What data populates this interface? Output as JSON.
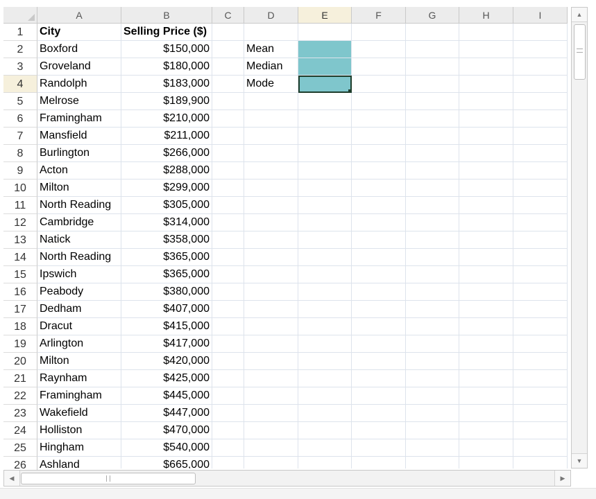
{
  "columns": [
    "A",
    "B",
    "C",
    "D",
    "E",
    "F",
    "G",
    "H",
    "I"
  ],
  "active_column": "E",
  "active_row": 4,
  "rows": [
    {
      "n": "1",
      "A": "City",
      "B": "Selling Price ($)",
      "D": ""
    },
    {
      "n": "2",
      "A": "Boxford",
      "B": "$150,000",
      "D": "Mean"
    },
    {
      "n": "3",
      "A": "Groveland",
      "B": "$180,000",
      "D": "Median"
    },
    {
      "n": "4",
      "A": "Randolph",
      "B": "$183,000",
      "D": "Mode"
    },
    {
      "n": "5",
      "A": "Melrose",
      "B": "$189,900",
      "D": ""
    },
    {
      "n": "6",
      "A": "Framingham",
      "B": "$210,000",
      "D": ""
    },
    {
      "n": "7",
      "A": "Mansfield",
      "B": "$211,000",
      "D": ""
    },
    {
      "n": "8",
      "A": "Burlington",
      "B": "$266,000",
      "D": ""
    },
    {
      "n": "9",
      "A": "Acton",
      "B": "$288,000",
      "D": ""
    },
    {
      "n": "10",
      "A": "Milton",
      "B": "$299,000",
      "D": ""
    },
    {
      "n": "11",
      "A": "North Reading",
      "B": "$305,000",
      "D": ""
    },
    {
      "n": "12",
      "A": "Cambridge",
      "B": "$314,000",
      "D": ""
    },
    {
      "n": "13",
      "A": "Natick",
      "B": "$358,000",
      "D": ""
    },
    {
      "n": "14",
      "A": "North Reading",
      "B": "$365,000",
      "D": ""
    },
    {
      "n": "15",
      "A": "Ipswich",
      "B": "$365,000",
      "D": ""
    },
    {
      "n": "16",
      "A": "Peabody",
      "B": "$380,000",
      "D": ""
    },
    {
      "n": "17",
      "A": "Dedham",
      "B": "$407,000",
      "D": ""
    },
    {
      "n": "18",
      "A": "Dracut",
      "B": "$415,000",
      "D": ""
    },
    {
      "n": "19",
      "A": "Arlington",
      "B": "$417,000",
      "D": ""
    },
    {
      "n": "20",
      "A": "Milton",
      "B": "$420,000",
      "D": ""
    },
    {
      "n": "21",
      "A": "Raynham",
      "B": "$425,000",
      "D": ""
    },
    {
      "n": "22",
      "A": "Framingham",
      "B": "$445,000",
      "D": ""
    },
    {
      "n": "23",
      "A": "Wakefield",
      "B": "$447,000",
      "D": ""
    },
    {
      "n": "24",
      "A": "Holliston",
      "B": "$470,000",
      "D": ""
    },
    {
      "n": "25",
      "A": "Hingham",
      "B": "$540,000",
      "D": ""
    },
    {
      "n": "26",
      "A": "Ashland",
      "B": "$665,000",
      "D": ""
    }
  ],
  "filled_cells": [
    "E2",
    "E3",
    "E4"
  ],
  "selected_cell": "E4",
  "colors": {
    "fill": "#7fc6cc",
    "selection_border": "#1e3d2b",
    "active_header": "#f6f0dc"
  },
  "scrollbars": {
    "up_arrow": "▲",
    "down_arrow": "▼",
    "left_arrow": "◀",
    "right_arrow": "▶"
  }
}
